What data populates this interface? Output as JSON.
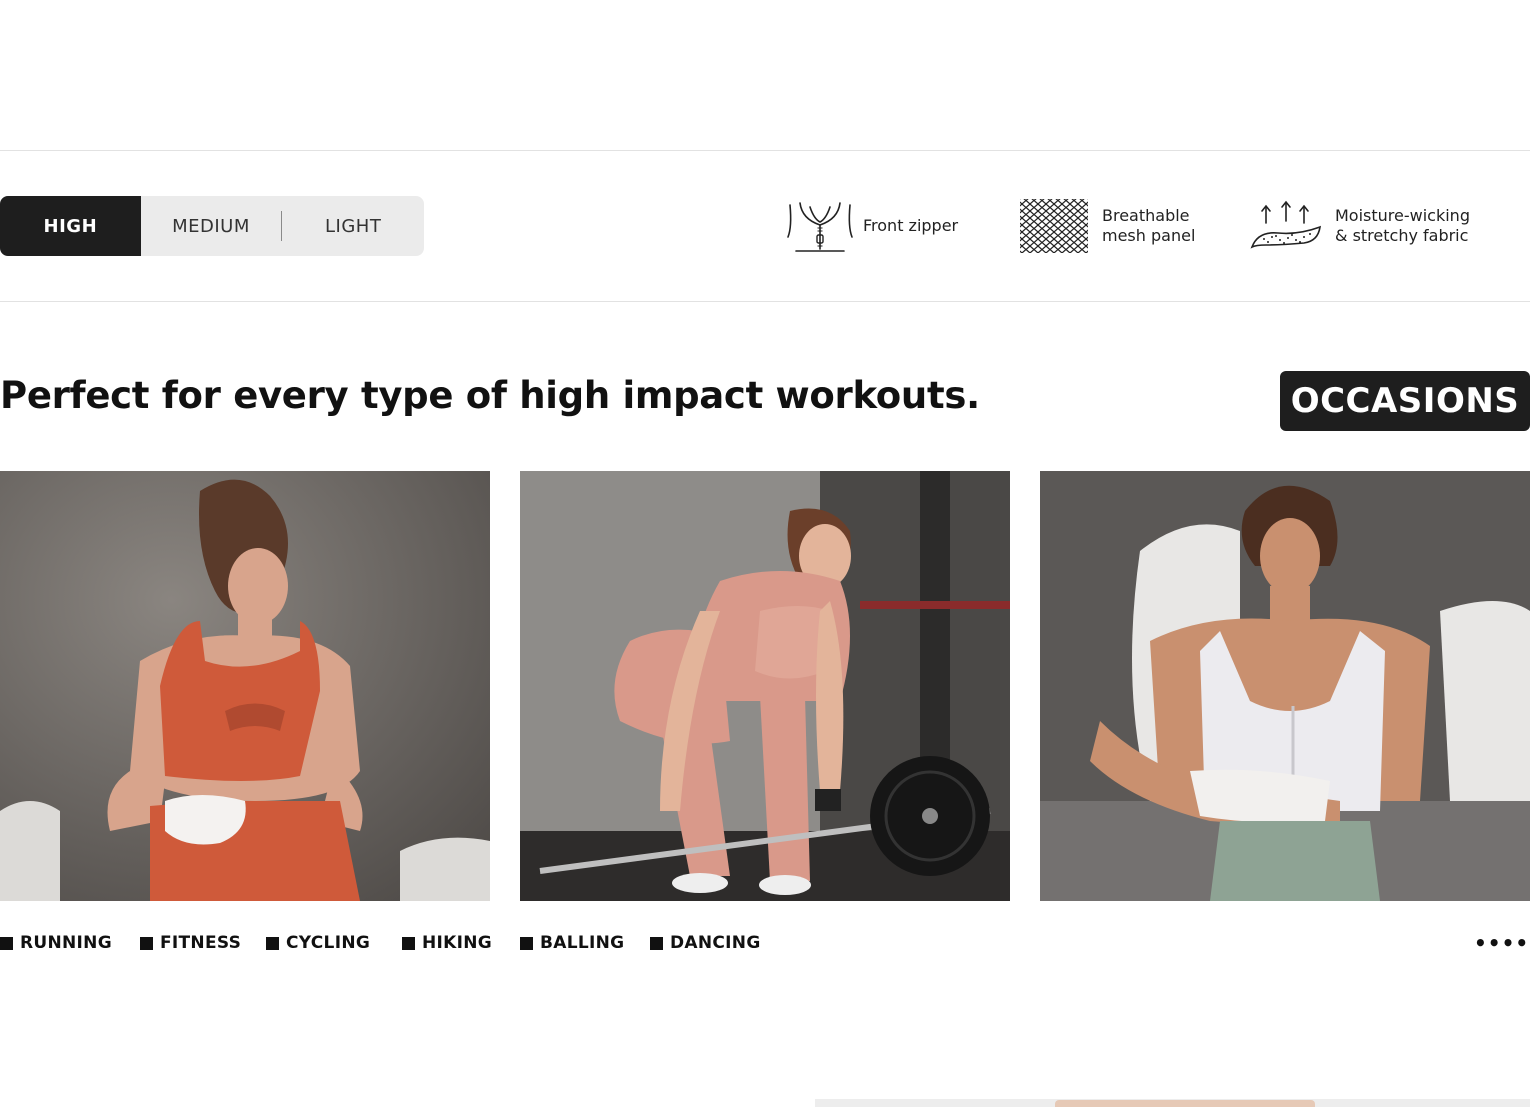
{
  "intensity": {
    "options": [
      "HIGH",
      "MEDIUM",
      "LIGHT"
    ],
    "selected": "HIGH"
  },
  "features": [
    {
      "icon": "front-zipper-icon",
      "lines": [
        "Front zipper"
      ]
    },
    {
      "icon": "mesh-panel-icon",
      "lines": [
        "Breathable",
        "mesh panel"
      ]
    },
    {
      "icon": "moisture-wicking-icon",
      "lines": [
        "Moisture-wicking",
        "& stretchy fabric"
      ]
    }
  ],
  "occasions": {
    "headline": "Perfect for every type of high impact workouts.",
    "badge": "OCCASIONS",
    "activities": [
      "RUNNING",
      "FITNESS",
      "CYCLING",
      "HIKING",
      "BALLING",
      "DANCING"
    ],
    "more": "••••••"
  },
  "colors": {
    "dark": "#1e1e1e",
    "segment_bg": "#ebebeb",
    "rule": "#e2e2e2",
    "orange_bra": "#cf5a3a",
    "pink_set": "#d9998a",
    "white_bra": "#ecebef",
    "sage_leggings": "#8ea394"
  }
}
